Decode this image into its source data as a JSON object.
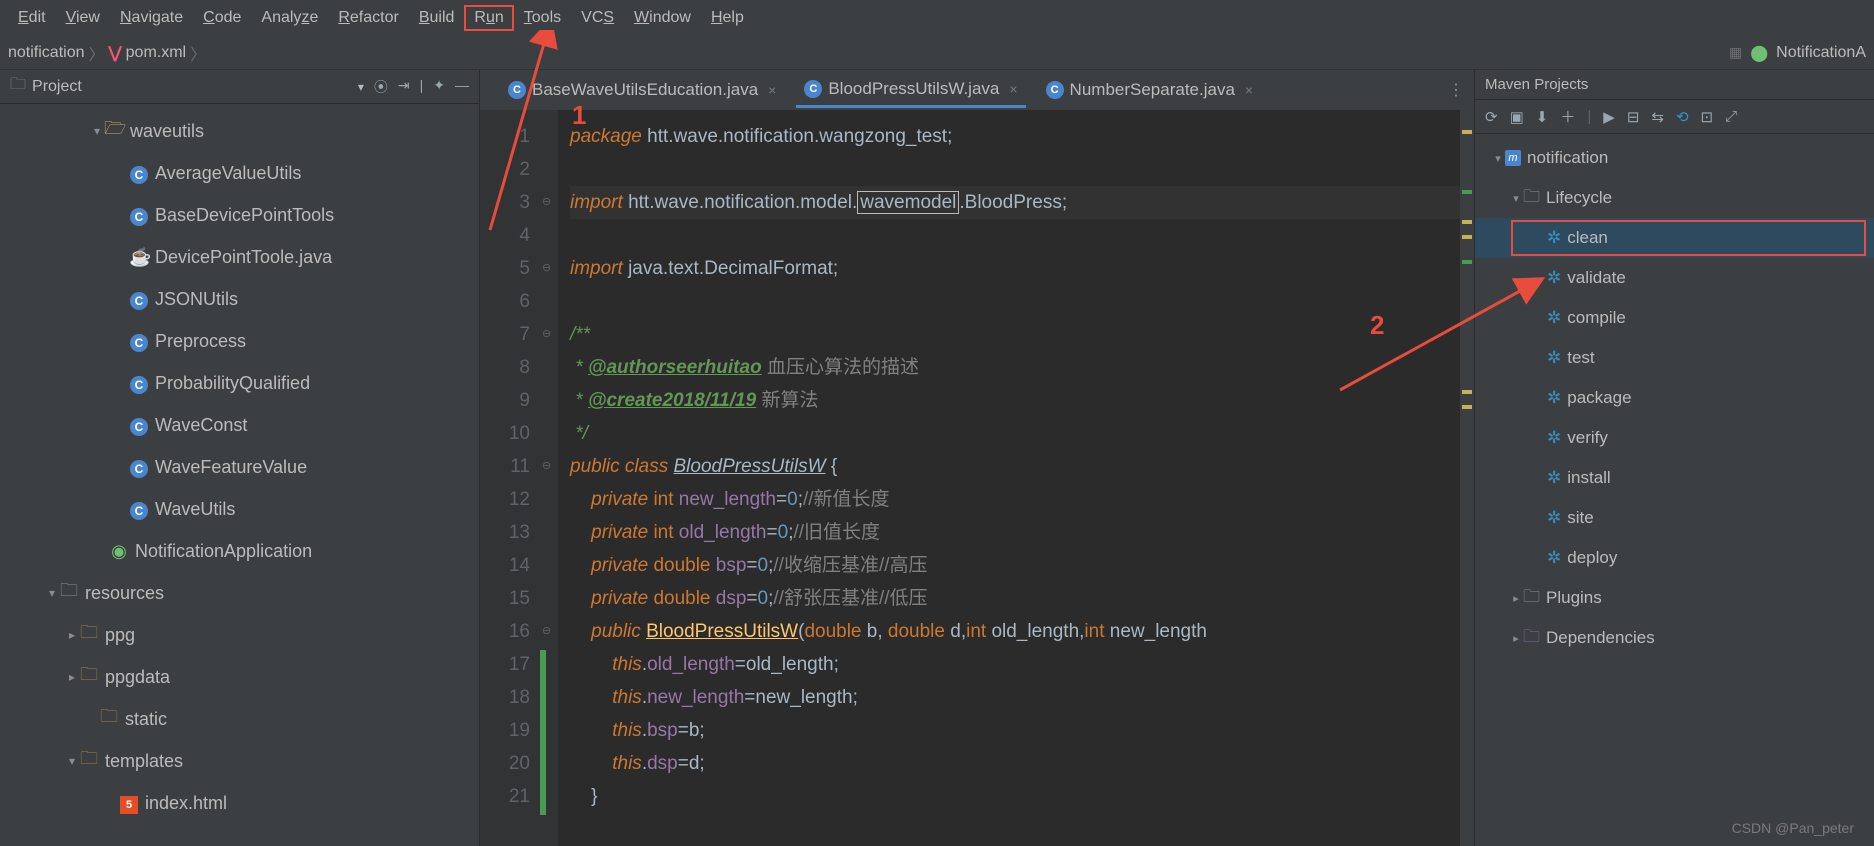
{
  "menu": [
    "Edit",
    "View",
    "Navigate",
    "Code",
    "Analyze",
    "Refactor",
    "Build",
    "Run",
    "Tools",
    "VCS",
    "Window",
    "Help"
  ],
  "breadcrumb": {
    "item1": "notification",
    "item2": "pom.xml",
    "run_config": "NotificationA"
  },
  "project": {
    "header": "Project",
    "tree": [
      {
        "indent": 90,
        "caret": "▾",
        "icon": "pkg-open",
        "label": "waveutils"
      },
      {
        "indent": 115,
        "caret": "",
        "icon": "class",
        "label": "AverageValueUtils"
      },
      {
        "indent": 115,
        "caret": "",
        "icon": "class",
        "label": "BaseDevicePointTools"
      },
      {
        "indent": 115,
        "caret": "",
        "icon": "java",
        "label": "DevicePointToole.java"
      },
      {
        "indent": 115,
        "caret": "",
        "icon": "class",
        "label": "JSONUtils"
      },
      {
        "indent": 115,
        "caret": "",
        "icon": "class",
        "label": "Preprocess"
      },
      {
        "indent": 115,
        "caret": "",
        "icon": "class",
        "label": "ProbabilityQualified"
      },
      {
        "indent": 115,
        "caret": "",
        "icon": "class",
        "label": "WaveConst"
      },
      {
        "indent": 115,
        "caret": "",
        "icon": "class",
        "label": "WaveFeatureValue"
      },
      {
        "indent": 115,
        "caret": "",
        "icon": "class",
        "label": "WaveUtils"
      },
      {
        "indent": 95,
        "caret": "",
        "icon": "spring",
        "label": "NotificationApplication"
      },
      {
        "indent": 45,
        "caret": "▾",
        "icon": "folder-r",
        "label": "resources"
      },
      {
        "indent": 65,
        "caret": "▸",
        "icon": "pkg",
        "label": "ppg"
      },
      {
        "indent": 65,
        "caret": "▸",
        "icon": "pkg",
        "label": "ppgdata"
      },
      {
        "indent": 85,
        "caret": "",
        "icon": "pkg",
        "label": "static"
      },
      {
        "indent": 65,
        "caret": "▾",
        "icon": "pkg",
        "label": "templates"
      },
      {
        "indent": 105,
        "caret": "",
        "icon": "html",
        "label": "index.html"
      }
    ]
  },
  "tabs": [
    {
      "label": "BaseWaveUtilsEducation.java",
      "active": false
    },
    {
      "label": "BloodPressUtilsW.java",
      "active": true
    },
    {
      "label": "NumberSeparate.java",
      "active": false
    }
  ],
  "code": {
    "lines": [
      {
        "n": 1,
        "html": "<span class='kw'>package</span> <span class='pkg'>htt.wave.notification.wangzong_test;</span>"
      },
      {
        "n": 2,
        "html": ""
      },
      {
        "n": 3,
        "html": "<span class='kw'>import</span> <span class='pkg'>htt.wave.notification.model.</span><span class='box'>wavemodel</span><span class='pkg'>.BloodPress;</span>",
        "hl": true
      },
      {
        "n": 4,
        "html": ""
      },
      {
        "n": 5,
        "html": "<span class='kw'>import</span> <span class='pkg'>java.text.DecimalFormat;</span>"
      },
      {
        "n": 6,
        "html": ""
      },
      {
        "n": 7,
        "html": "<span class='doc'>/**</span>"
      },
      {
        "n": 8,
        "html": "<span class='doc'> * </span><span class='doctag'>@authorseerhuitao</span> <span class='cmt'>血压心算法的描述</span>"
      },
      {
        "n": 9,
        "html": "<span class='doc'> * </span><span class='doctag'>@create2018/11/19</span> <span class='cmt'>新算法</span>"
      },
      {
        "n": 10,
        "html": "<span class='doc'> */</span>"
      },
      {
        "n": 11,
        "html": "<span class='kw'>public class</span> <span class='cls'>BloodPressUtilsW</span> {"
      },
      {
        "n": 12,
        "html": "    <span class='kw'>private</span> <span class='type'>int</span> <span class='field'>new_length</span>=<span class='num'>0</span>;<span class='cmt'>//新值长度</span>"
      },
      {
        "n": 13,
        "html": "    <span class='kw'>private</span> <span class='type'>int</span> <span class='field'>old_length</span>=<span class='num'>0</span>;<span class='cmt'>//旧值长度</span>"
      },
      {
        "n": 14,
        "html": "    <span class='kw'>private</span> <span class='type'>double</span> <span class='field'>bsp</span>=<span class='num'>0</span>;<span class='cmt'>//收缩压基准//高压</span>"
      },
      {
        "n": 15,
        "html": "    <span class='kw'>private</span> <span class='type'>double</span> <span class='field'>dsp</span>=<span class='num'>0</span>;<span class='cmt'>//舒张压基准//低压</span>"
      },
      {
        "n": 16,
        "html": "    <span class='kw'>public</span> <span class='method'>BloodPressUtilsW</span>(<span class='type'>double</span> b, <span class='type'>double</span> d,<span class='type'>int</span> old_length,<span class='type'>int</span> new_length"
      },
      {
        "n": 17,
        "html": "        <span class='kw'>this</span>.<span class='field'>old_length</span>=old_length;"
      },
      {
        "n": 18,
        "html": "        <span class='kw'>this</span>.<span class='field'>new_length</span>=new_length;"
      },
      {
        "n": 19,
        "html": "        <span class='kw'>this</span>.<span class='field'>bsp</span>=b;"
      },
      {
        "n": 20,
        "html": "        <span class='kw'>this</span>.<span class='field'>dsp</span>=d;"
      },
      {
        "n": 21,
        "html": "    }"
      }
    ]
  },
  "maven": {
    "title": "Maven Projects",
    "tree": [
      {
        "indent": 8,
        "caret": "▾",
        "icon": "m",
        "label": "notification"
      },
      {
        "indent": 26,
        "caret": "▾",
        "icon": "folder",
        "label": "Lifecycle"
      },
      {
        "indent": 50,
        "caret": "",
        "icon": "gear",
        "label": "clean",
        "hl": true
      },
      {
        "indent": 50,
        "caret": "",
        "icon": "gear",
        "label": "validate"
      },
      {
        "indent": 50,
        "caret": "",
        "icon": "gear",
        "label": "compile"
      },
      {
        "indent": 50,
        "caret": "",
        "icon": "gear",
        "label": "test"
      },
      {
        "indent": 50,
        "caret": "",
        "icon": "gear",
        "label": "package"
      },
      {
        "indent": 50,
        "caret": "",
        "icon": "gear",
        "label": "verify"
      },
      {
        "indent": 50,
        "caret": "",
        "icon": "gear",
        "label": "install"
      },
      {
        "indent": 50,
        "caret": "",
        "icon": "gear",
        "label": "site"
      },
      {
        "indent": 50,
        "caret": "",
        "icon": "gear",
        "label": "deploy"
      },
      {
        "indent": 26,
        "caret": "▸",
        "icon": "folder",
        "label": "Plugins"
      },
      {
        "indent": 26,
        "caret": "▸",
        "icon": "folder-dep",
        "label": "Dependencies"
      }
    ]
  },
  "annotations": {
    "a1": "1",
    "a2": "2",
    "watermark": "CSDN @Pan_peter"
  }
}
